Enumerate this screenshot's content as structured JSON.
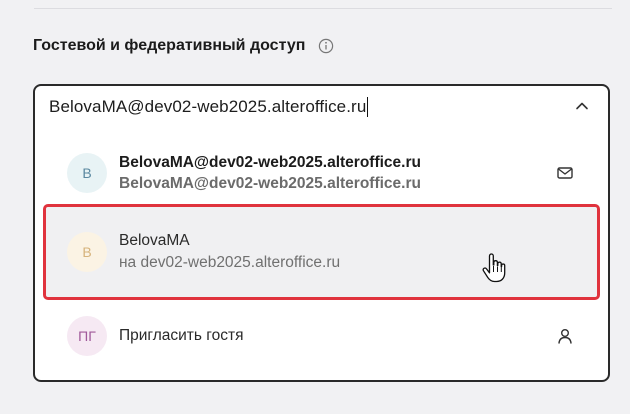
{
  "section": {
    "title": "Гостевой и федеративный доступ"
  },
  "search": {
    "value": "BelovaMA@dev02-web2025.alteroffice.ru"
  },
  "options": [
    {
      "avatar": "В",
      "line1": "BelovaMA@dev02-web2025.alteroffice.ru",
      "line2": "BelovaMA@dev02-web2025.alteroffice.ru",
      "icon": "mail-icon"
    },
    {
      "avatar": "В",
      "line1": "BelovaMA",
      "line2": "на dev02-web2025.alteroffice.ru",
      "highlighted": true
    },
    {
      "avatar": "ПГ",
      "line1": "Пригласить гостя",
      "icon": "person-icon"
    }
  ],
  "colors": {
    "highlight_border": "#e0333d",
    "avatar_blue_bg": "#e8f3f5",
    "avatar_yellow_bg": "#fbf3e4",
    "avatar_pink_bg": "#f6e9f3"
  }
}
